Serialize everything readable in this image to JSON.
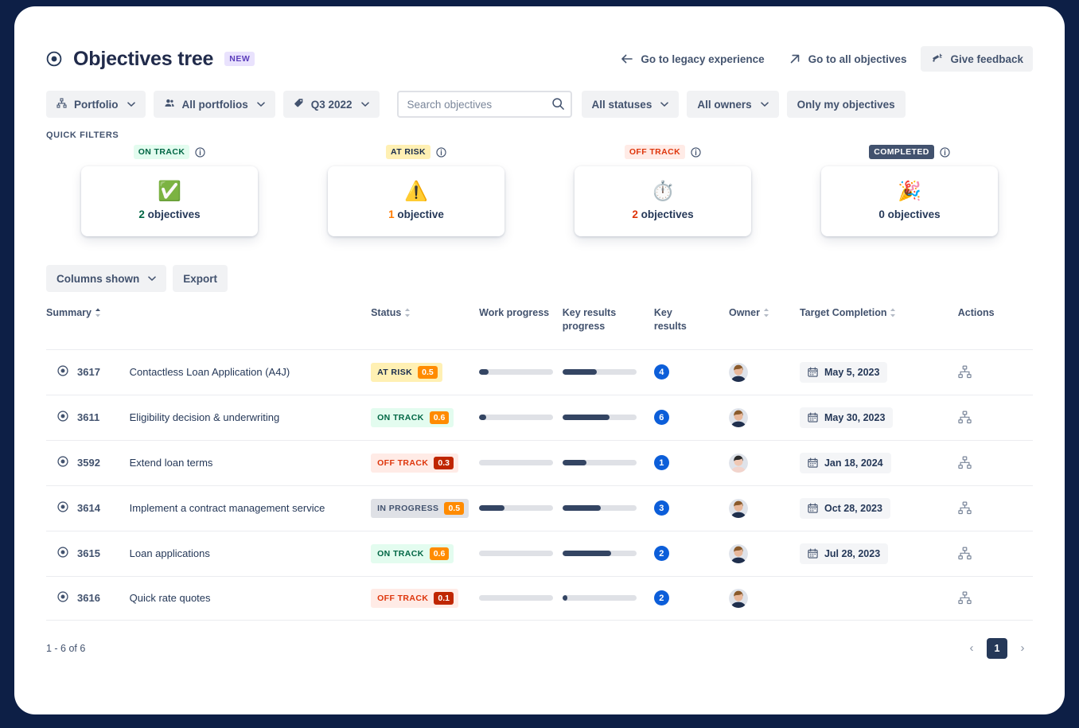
{
  "header": {
    "title": "Objectives tree",
    "new_badge": "NEW",
    "links": [
      {
        "label": "Go to legacy experience",
        "icon": "arrow-left-icon",
        "filled": false
      },
      {
        "label": "Go to all objectives",
        "icon": "arrow-up-right-icon",
        "filled": false
      },
      {
        "label": "Give feedback",
        "icon": "megaphone-icon",
        "filled": true
      }
    ]
  },
  "filters": {
    "pills": [
      {
        "label": "Portfolio",
        "icon": "hierarchy-icon",
        "caret": true
      },
      {
        "label": "All portfolios",
        "icon": "people-icon",
        "caret": true
      },
      {
        "label": "Q3 2022",
        "icon": "tag-icon",
        "caret": true
      }
    ],
    "search": {
      "placeholder": "Search objectives",
      "value": ""
    },
    "right_pills": [
      {
        "label": "All statuses",
        "caret": true
      },
      {
        "label": "All owners",
        "caret": true
      },
      {
        "label": "Only my objectives",
        "caret": false
      }
    ]
  },
  "quick_filters": {
    "section_label": "QUICK FILTERS",
    "cards": [
      {
        "status": "ON TRACK",
        "status_bg": "#e3fcef",
        "status_color": "#006644",
        "emoji": "✅",
        "count": "2",
        "unit": "objectives",
        "count_color": "#006644"
      },
      {
        "status": "AT RISK",
        "status_bg": "#fff0b3",
        "status_color": "#172b4d",
        "emoji": "⚠️",
        "count": "1",
        "unit": "objective",
        "count_color": "#ff7a00"
      },
      {
        "status": "OFF TRACK",
        "status_bg": "#ffebe6",
        "status_color": "#de350b",
        "emoji": "⏱️",
        "count": "2",
        "unit": "objectives",
        "count_color": "#de350b"
      },
      {
        "status": "COMPLETED",
        "status_bg": "#42526e",
        "status_color": "#ffffff",
        "emoji": "🎉",
        "count": "0",
        "unit": "objectives",
        "count_color": "#253858"
      }
    ]
  },
  "toolbar": {
    "columns_shown": "Columns shown",
    "export": "Export"
  },
  "table": {
    "columns": [
      {
        "label": "Summary",
        "sortable": true,
        "sorted": "asc"
      },
      {
        "label": "Status",
        "sortable": true
      },
      {
        "label": "Work progress",
        "sortable": false
      },
      {
        "label": "Key results progress",
        "sortable": false
      },
      {
        "label": "Key results",
        "sortable": false
      },
      {
        "label": "Owner",
        "sortable": true
      },
      {
        "label": "Target Completion",
        "sortable": true
      },
      {
        "label": "Actions",
        "sortable": false
      }
    ],
    "rows": [
      {
        "key": "3617",
        "summary": "Contactless Loan Application (A4J)",
        "status_label": "AT RISK",
        "status_value": "0.5",
        "status_bg": "#fff0b3",
        "status_color": "#172b4d",
        "value_bg": "#ff8b00",
        "work_progress": 13,
        "kr_progress": 46,
        "key_results": "4",
        "owner_hair": "#8a5a2b",
        "owner_shirt": "#1f2f4d",
        "owner_skin": "#e8b89b",
        "target_completion": "May 5, 2023"
      },
      {
        "key": "3611",
        "summary": "Eligibility decision & underwriting",
        "status_label": "ON TRACK",
        "status_value": "0.6",
        "status_bg": "#e3fcef",
        "status_color": "#006644",
        "value_bg": "#ff8b00",
        "work_progress": 10,
        "kr_progress": 64,
        "key_results": "6",
        "owner_hair": "#8a5a2b",
        "owner_shirt": "#1f2f4d",
        "owner_skin": "#e8b89b",
        "target_completion": "May 30, 2023"
      },
      {
        "key": "3592",
        "summary": "Extend loan terms",
        "status_label": "OFF TRACK",
        "status_value": "0.3",
        "status_bg": "#ffebe6",
        "status_color": "#de350b",
        "value_bg": "#bf2600",
        "work_progress": 0,
        "kr_progress": 32,
        "key_results": "1",
        "owner_hair": "#2b2b2b",
        "owner_shirt": "#f2d4cc",
        "owner_skin": "#f0c8b4",
        "target_completion": "Jan 18, 2024"
      },
      {
        "key": "3614",
        "summary": "Implement a contract management service",
        "status_label": "IN PROGRESS",
        "status_value": "0.5",
        "status_bg": "#dfe1e6",
        "status_color": "#42526e",
        "value_bg": "#ff8b00",
        "work_progress": 34,
        "kr_progress": 52,
        "key_results": "3",
        "owner_hair": "#8a5a2b",
        "owner_shirt": "#1f2f4d",
        "owner_skin": "#e8b89b",
        "target_completion": "Oct 28, 2023"
      },
      {
        "key": "3615",
        "summary": "Loan applications",
        "status_label": "ON TRACK",
        "status_value": "0.6",
        "status_bg": "#e3fcef",
        "status_color": "#006644",
        "value_bg": "#ff8b00",
        "work_progress": 0,
        "kr_progress": 66,
        "key_results": "2",
        "owner_hair": "#8a5a2b",
        "owner_shirt": "#1f2f4d",
        "owner_skin": "#e8b89b",
        "target_completion": "Jul 28, 2023"
      },
      {
        "key": "3616",
        "summary": "Quick rate quotes",
        "status_label": "OFF TRACK",
        "status_value": "0.1",
        "status_bg": "#ffebe6",
        "status_color": "#de350b",
        "value_bg": "#bf2600",
        "work_progress": 0,
        "kr_progress": 7,
        "key_results": "2",
        "owner_hair": "#8a5a2b",
        "owner_shirt": "#1f2f4d",
        "owner_skin": "#e8b89b",
        "target_completion": ""
      }
    ]
  },
  "footer": {
    "count_text": "1 - 6 of 6",
    "prev": "‹",
    "page": "1",
    "next": "›"
  }
}
